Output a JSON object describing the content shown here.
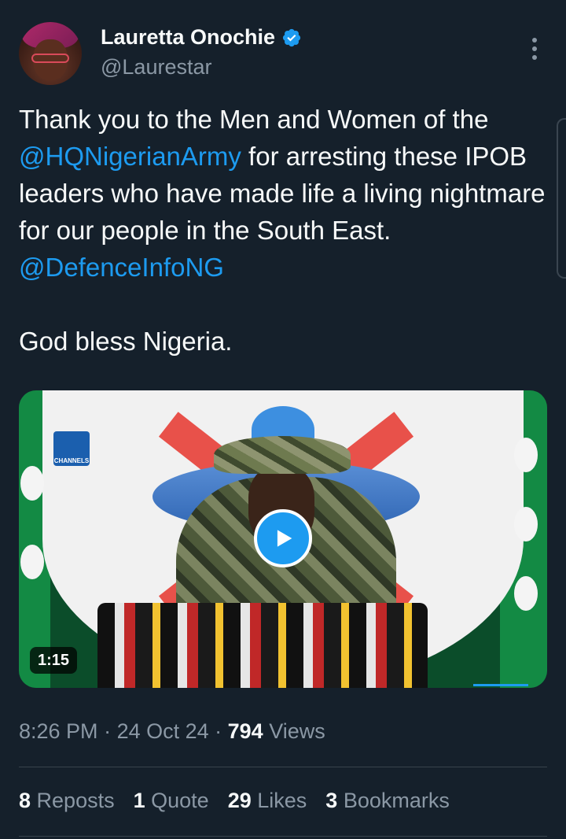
{
  "author": {
    "display_name": "Lauretta Onochie",
    "handle": "@Laurestar",
    "verified": true,
    "avatar_icon": "profile-photo"
  },
  "tweet": {
    "text_before_mention": "Thank you to the Men and Women of the ",
    "mention_1": "@HQNigerianArmy",
    "text_middle": " for arresting these IPOB leaders who have made life a living nightmare for our people in the South East. ",
    "mention_2": "@DefenceInfoNG",
    "second_paragraph": "God bless Nigeria."
  },
  "media": {
    "type": "video",
    "duration": "1:15",
    "play_icon": "play-icon",
    "watermark": "CHANNELS"
  },
  "meta": {
    "time": "8:26 PM",
    "sep1": " · ",
    "date": "24 Oct 24",
    "sep2": " · ",
    "views_count": "794",
    "views_label": " Views"
  },
  "stats": {
    "reposts_count": "8",
    "reposts_label": " Reposts",
    "quotes_count": "1",
    "quotes_label": " Quote",
    "likes_count": "29",
    "likes_label": " Likes",
    "bookmarks_count": "3",
    "bookmarks_label": " Bookmarks"
  },
  "colors": {
    "background": "#15202b",
    "accent": "#1d9bf0",
    "secondary_text": "#8b98a5"
  }
}
